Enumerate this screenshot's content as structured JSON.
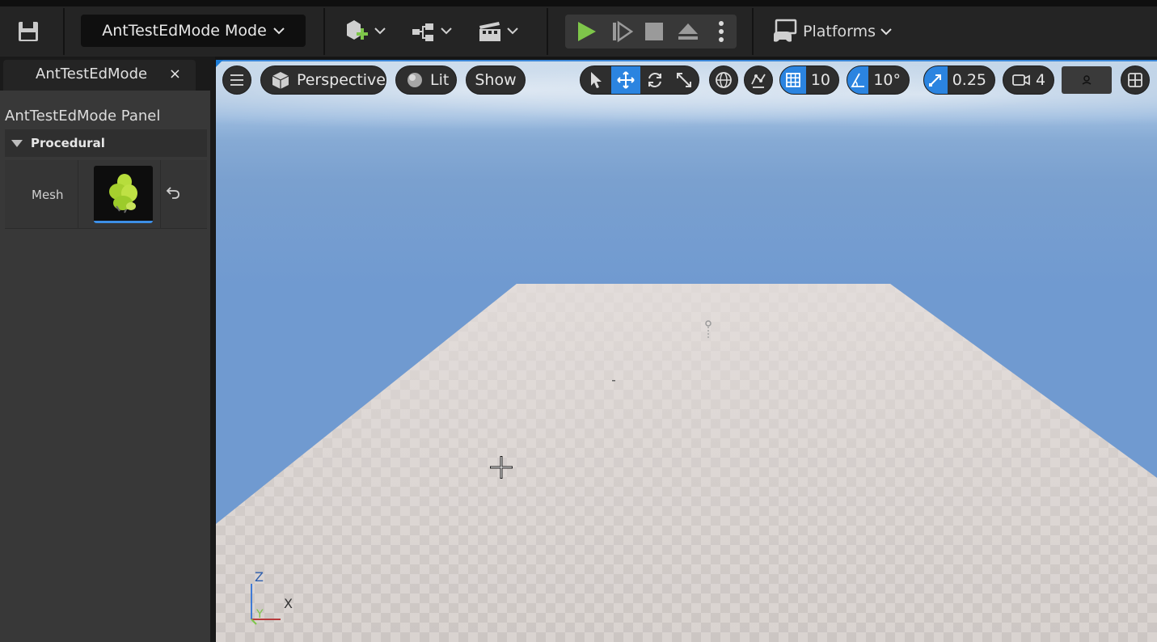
{
  "toolbar": {
    "mode_label": "AntTestEdMode Mode",
    "platforms_label": "Platforms",
    "icons": [
      "save-icon",
      "add-actor-icon",
      "blueprint-icon",
      "cinematics-icon",
      "play-icon",
      "step-icon",
      "stop-icon",
      "eject-icon",
      "more-icon",
      "platforms-icon"
    ],
    "colors": {
      "play": "#7ec64a",
      "background": "#242424"
    }
  },
  "left_panel": {
    "tab_title": "AntTestEdMode",
    "close_glyph": "×",
    "panel_title": "AntTestEdMode Panel",
    "category": "Procedural",
    "property_name": "Mesh"
  },
  "viewport": {
    "view_mode": "Perspective",
    "lighting": "Lit",
    "show": "Show",
    "grid_snap": "10",
    "rotation_snap": "10°",
    "scale_snap": "0.25",
    "camera_speed": "4",
    "axes": {
      "z": "Z",
      "x": "X",
      "y": "Y"
    },
    "colors": {
      "accent": "#2b84e0",
      "sky": "#709ad0",
      "floor": "#d9d3d0"
    }
  }
}
